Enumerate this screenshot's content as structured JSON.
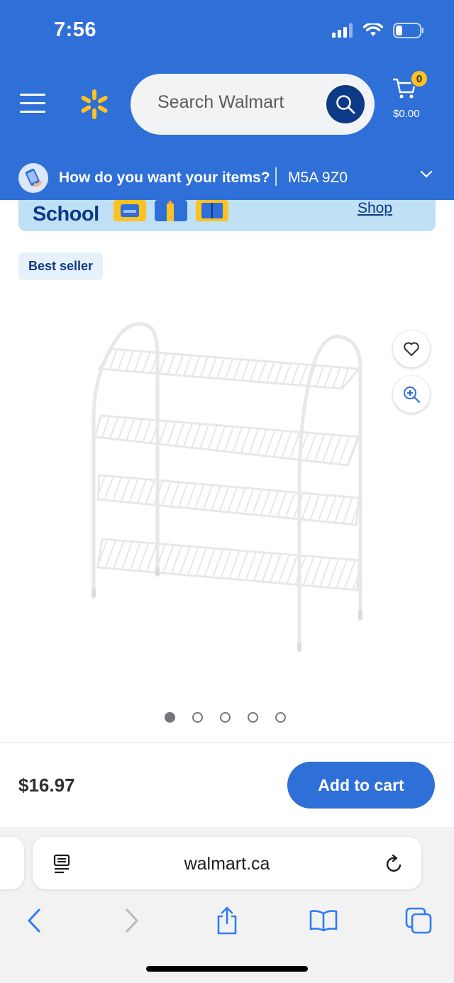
{
  "status_bar": {
    "time": "7:56"
  },
  "header": {
    "search_placeholder": "Search Walmart",
    "cart": {
      "count": "0",
      "total": "$0.00"
    },
    "delivery": {
      "question": "How do you want your items?",
      "postal_code": "M5A 9Z0"
    },
    "colors": {
      "primary": "#2f6fd8",
      "spark": "#ffc220",
      "dark_blue": "#0d3a86"
    }
  },
  "banner": {
    "title": "School",
    "link": "Shop"
  },
  "product": {
    "badge": "Best seller",
    "image_count": 5,
    "active_image": 1,
    "price": "$16.97",
    "add_to_cart": "Add to cart"
  },
  "browser": {
    "url": "walmart.ca"
  }
}
